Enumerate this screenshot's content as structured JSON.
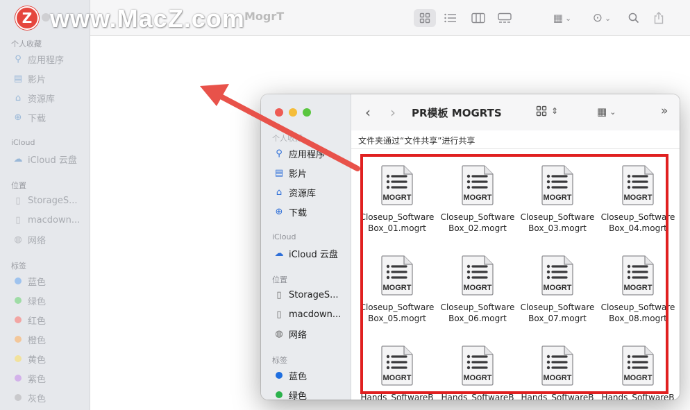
{
  "watermark": {
    "logo": "Z",
    "text": "www.MacZ.com"
  },
  "background_window": {
    "title": "MogrT",
    "sidebar": {
      "favorites_header": "个人收藏",
      "favorites": [
        "应用程序",
        "影片",
        "资源库",
        "下载"
      ],
      "icloud_header": "iCloud",
      "icloud": [
        "iCloud 云盘"
      ],
      "locations_header": "位置",
      "locations": [
        "StorageS...",
        "macdown...",
        "网络"
      ],
      "tags_header": "标签",
      "tags": [
        {
          "label": "蓝色",
          "color": "#9fc3ee"
        },
        {
          "label": "绿色",
          "color": "#9fdca6"
        },
        {
          "label": "红色",
          "color": "#f2a5a3"
        },
        {
          "label": "橙色",
          "color": "#f3c79a"
        },
        {
          "label": "黄色",
          "color": "#f2e29c"
        },
        {
          "label": "紫色",
          "color": "#d3b2ea"
        },
        {
          "label": "灰色",
          "color": "#c9c9cc"
        }
      ]
    }
  },
  "front_window": {
    "title": "PR模板 MOGRTS",
    "path_bar": "文件夹通过“文件共享”进行共享",
    "sidebar": {
      "favorites_header": "个人收藏",
      "favorites": [
        "应用程序",
        "影片",
        "资源库",
        "下载"
      ],
      "icloud_header": "iCloud",
      "icloud": [
        "iCloud 云盘"
      ],
      "locations_header": "位置",
      "locations": [
        "StorageS...",
        "macdown...",
        "网络"
      ],
      "tags_header": "标签",
      "tags": [
        {
          "label": "蓝色",
          "color": "#1f6fe0"
        },
        {
          "label": "绿色",
          "color": "#2bb24c"
        }
      ]
    },
    "file_badge": "MOGRT",
    "files": [
      {
        "line1": "Closeup_Software",
        "line2": "Box_01.mogrt"
      },
      {
        "line1": "Closeup_Software",
        "line2": "Box_02.mogrt"
      },
      {
        "line1": "Closeup_Software",
        "line2": "Box_03.mogrt"
      },
      {
        "line1": "Closeup_Software",
        "line2": "Box_04.mogrt"
      },
      {
        "line1": "Closeup_Software",
        "line2": "Box_05.mogrt"
      },
      {
        "line1": "Closeup_Software",
        "line2": "Box_06.mogrt"
      },
      {
        "line1": "Closeup_Software",
        "line2": "Box_07.mogrt"
      },
      {
        "line1": "Closeup_Software",
        "line2": "Box_08.mogrt"
      },
      {
        "line1": "Hands_SoftwareB",
        "line2": ""
      },
      {
        "line1": "Hands_SoftwareB",
        "line2": ""
      },
      {
        "line1": "Hands_SoftwareB",
        "line2": ""
      },
      {
        "line1": "Hands_SoftwareB",
        "line2": ""
      }
    ]
  },
  "colors": {
    "annotation_red": "#e02020",
    "arrow_red": "#e8524a"
  }
}
